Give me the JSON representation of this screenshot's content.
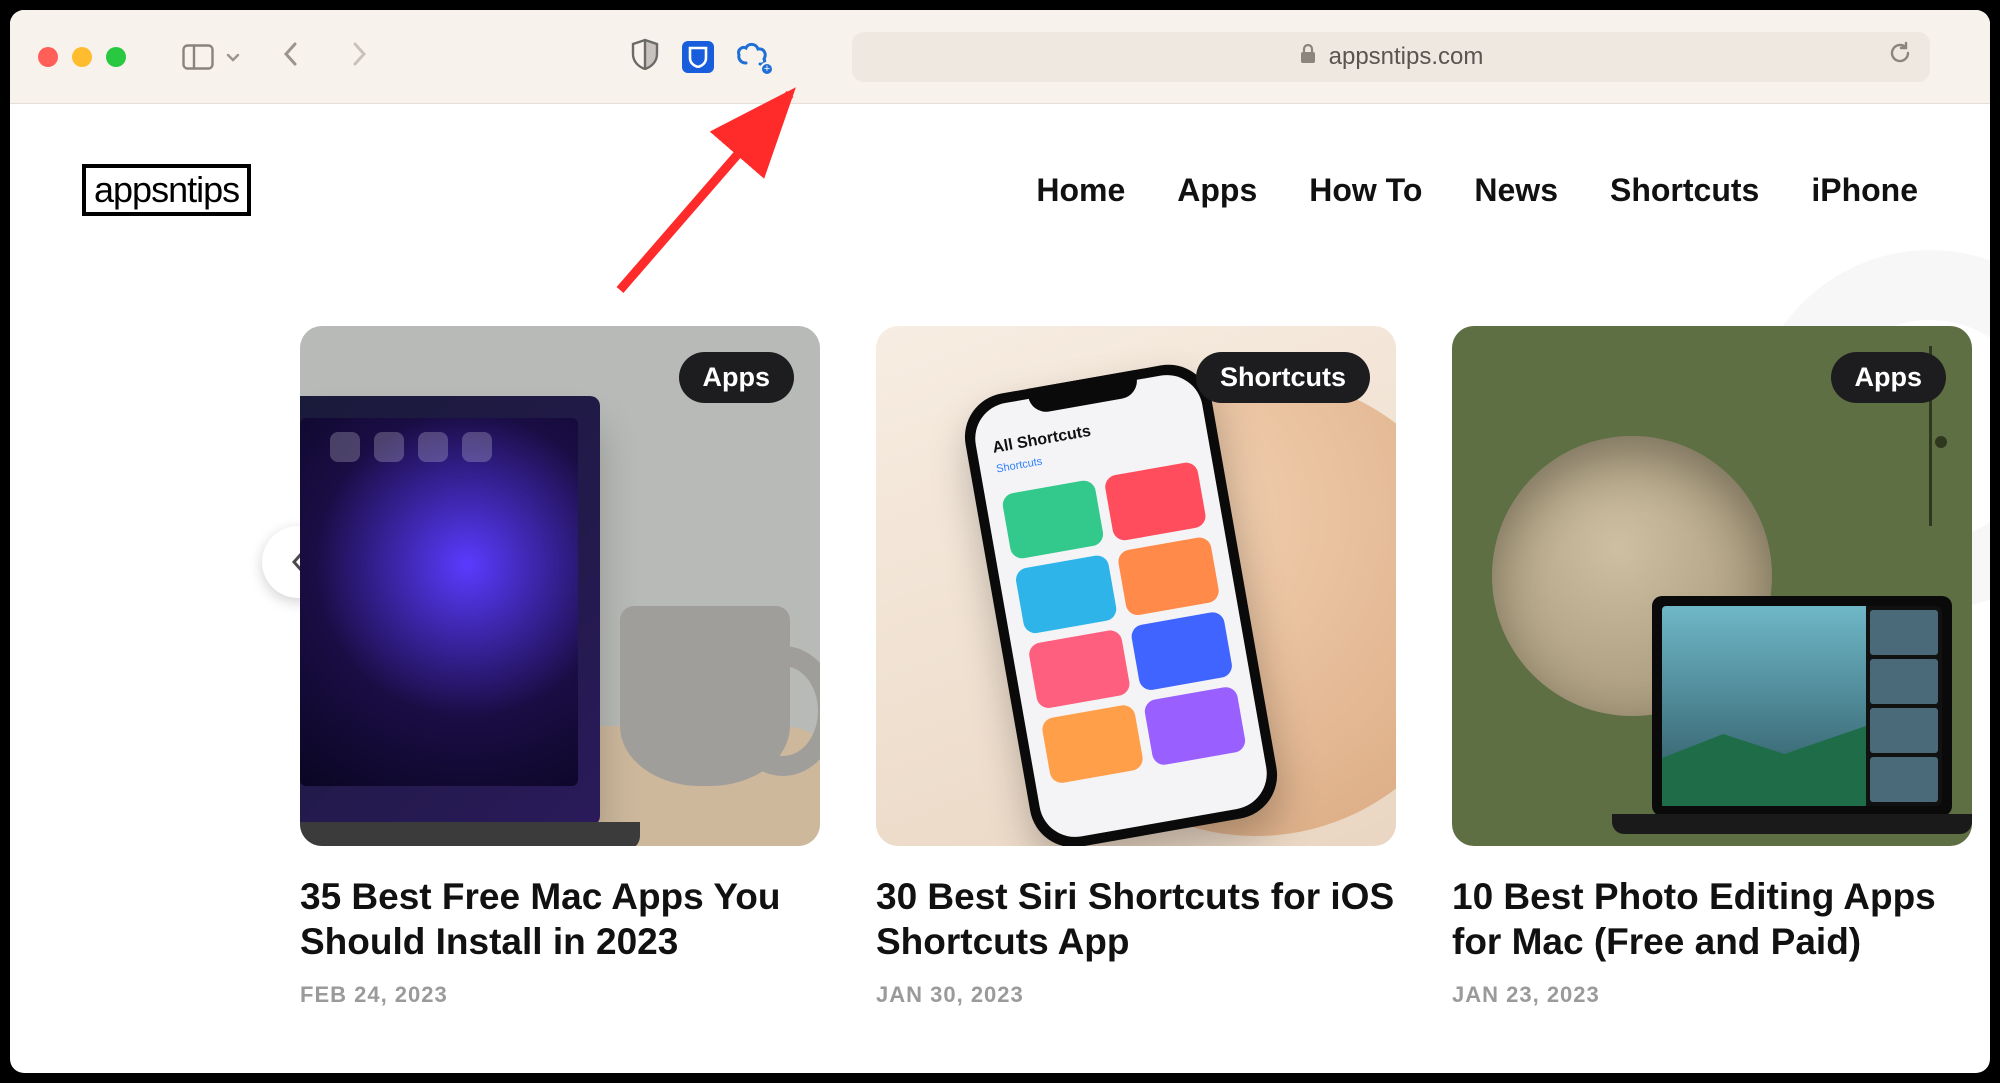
{
  "browser": {
    "url_host": "appsntips.com"
  },
  "site": {
    "logo_text": "appsntips",
    "nav": [
      "Home",
      "Apps",
      "How To",
      "News",
      "Shortcuts",
      "iPhone"
    ]
  },
  "phone_ui": {
    "back_label": "Shortcuts",
    "title": "All Shortcuts"
  },
  "cards": [
    {
      "badge": "Apps",
      "title": "35 Best Free Mac Apps You Should Install in 2023",
      "date": "FEB 24, 2023"
    },
    {
      "badge": "Shortcuts",
      "title": "30 Best Siri Shortcuts for iOS Shortcuts App",
      "date": "JAN 30, 2023"
    },
    {
      "badge": "Apps",
      "title": "10 Best Photo Editing Apps for Mac (Free and Paid)",
      "date": "JAN 23, 2023"
    }
  ]
}
